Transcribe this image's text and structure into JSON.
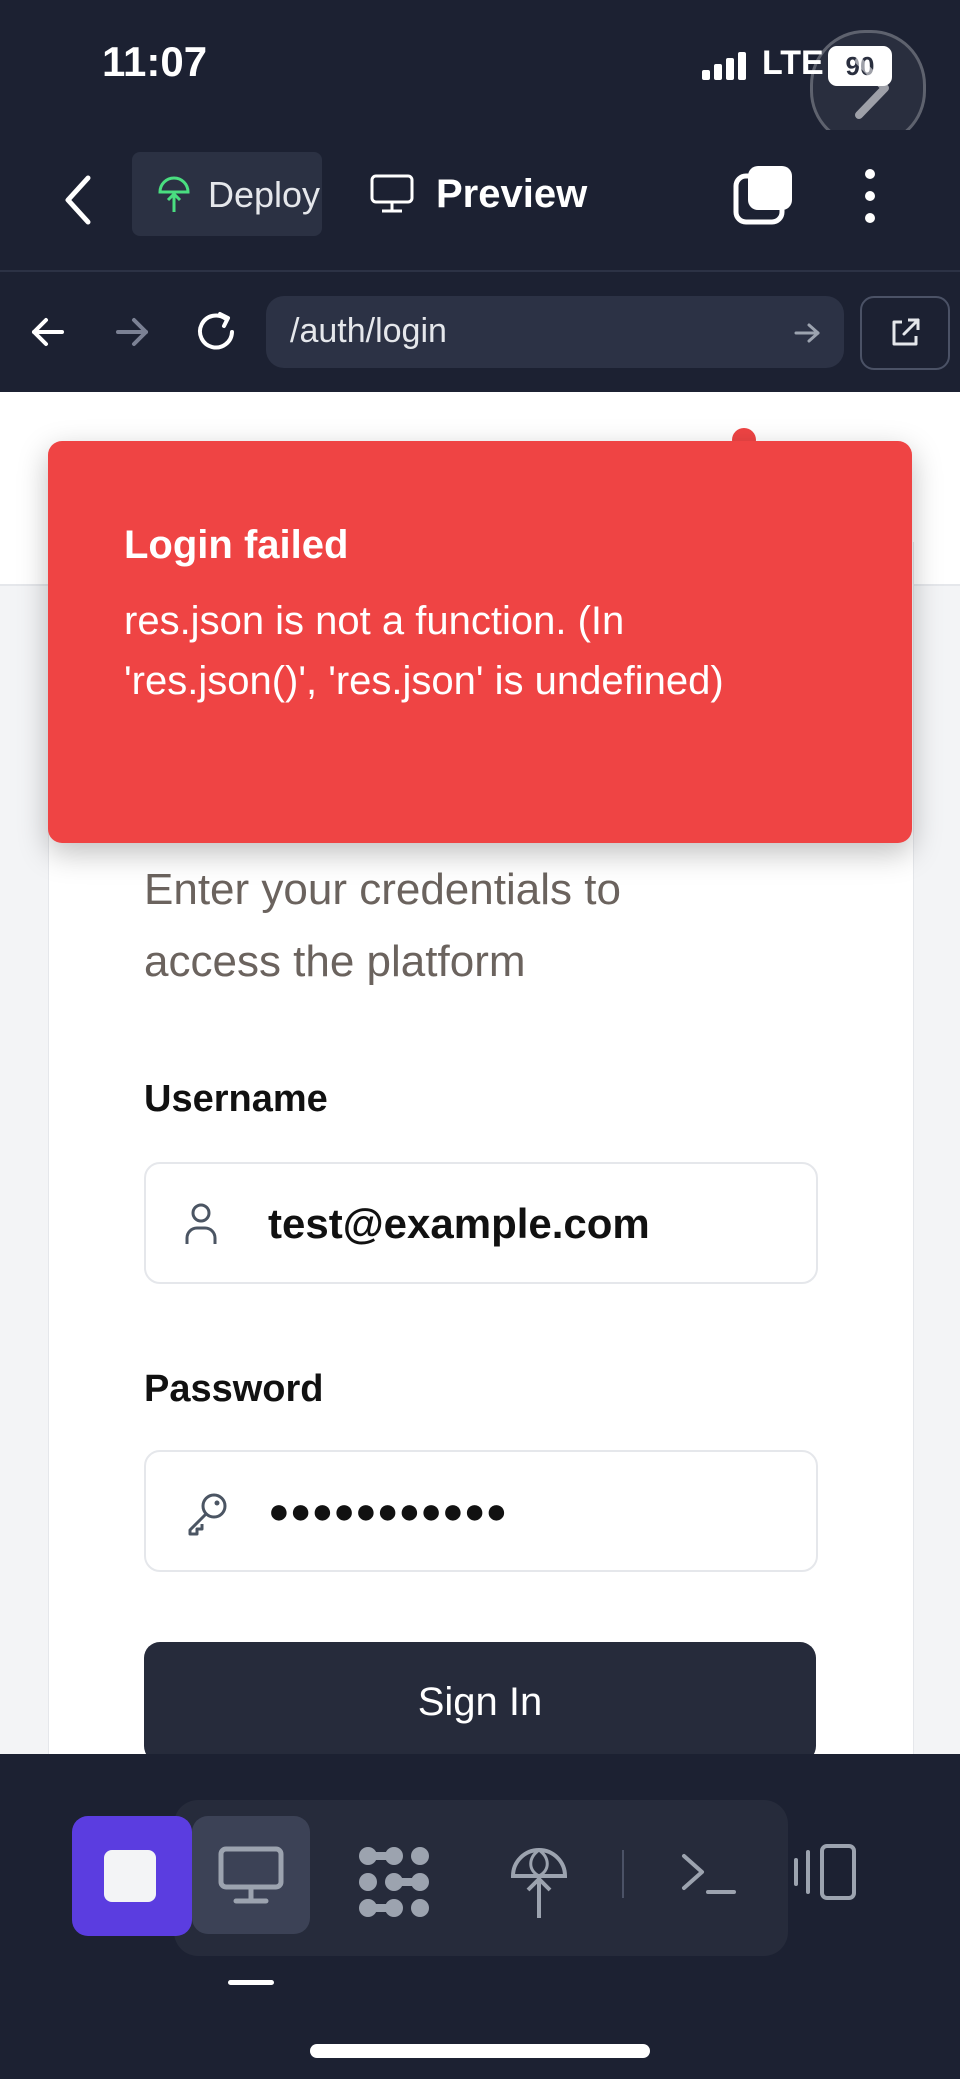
{
  "status_bar": {
    "time": "11:07",
    "network": "LTE",
    "battery": "90"
  },
  "toolbar": {
    "deploy_label": "Deploy",
    "preview_label": "Preview"
  },
  "address_bar": {
    "url": "/auth/login"
  },
  "toast": {
    "title": "Login failed",
    "message": "res.json is not a function. (In 'res.json()', 'res.json' is undefined)",
    "color": "#ef4444"
  },
  "login_form": {
    "subtitle": "Enter your credentials to access the platform",
    "username_label": "Username",
    "username_value": "test@example.com",
    "password_label": "Password",
    "password_value": "●●●●●●●●●●●",
    "submit_label": "Sign In",
    "submit_color": "#262b3b"
  },
  "bottom_nav": {
    "items": [
      "stop-icon",
      "monitor-icon",
      "dots-grid-icon",
      "deploy-icon",
      "terminal-icon",
      "layout-icon"
    ],
    "accent": "#5b3de0"
  }
}
